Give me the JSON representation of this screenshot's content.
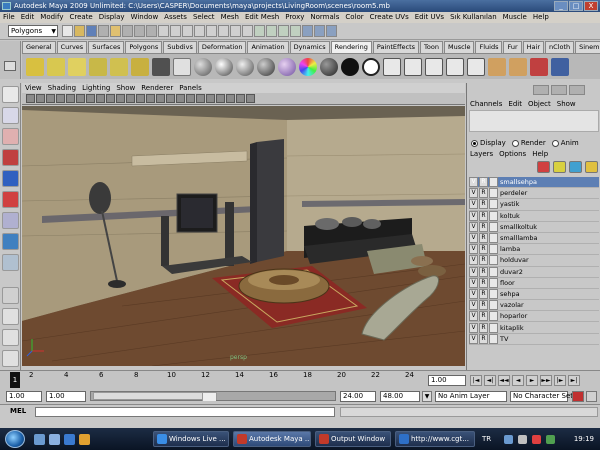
{
  "window": {
    "title": "Autodesk Maya 2009 Unlimited: C:\\Users\\CASPER\\Documents\\maya\\projects\\LivingRoom\\scenes\\room5.mb",
    "controls": [
      "_",
      "□",
      "X"
    ]
  },
  "menubar": [
    "File",
    "Edit",
    "Modify",
    "Create",
    "Display",
    "Window",
    "Assets",
    "Select",
    "Mesh",
    "Edit Mesh",
    "Proxy",
    "Normals",
    "Color",
    "Create UVs",
    "Edit UVs",
    "Sık Kullanılan",
    "Muscle",
    "Help"
  ],
  "mode_selector": {
    "value": "Polygons"
  },
  "shelf_tabs": [
    "General",
    "Curves",
    "Surfaces",
    "Polygons",
    "Subdivs",
    "Deformation",
    "Animation",
    "Dynamics",
    "Rendering",
    "PaintEffects",
    "Toon",
    "Muscle",
    "Fluids",
    "Fur",
    "Hair",
    "nCloth",
    "Sinem",
    "ersin"
  ],
  "active_shelf_tab": "Rendering",
  "panel_menu": [
    "View",
    "Shading",
    "Lighting",
    "Show",
    "Renderer",
    "Panels"
  ],
  "viewport": {
    "camera_label": "persp"
  },
  "channel_box": {
    "menu": [
      "Channels",
      "Edit",
      "Object",
      "Show"
    ]
  },
  "layer_editor": {
    "modes": [
      {
        "label": "Display",
        "selected": true
      },
      {
        "label": "Render",
        "selected": false
      },
      {
        "label": "Anim",
        "selected": false
      }
    ],
    "menu": [
      "Layers",
      "Options",
      "Help"
    ],
    "layers": [
      {
        "name": "smallsehpa",
        "v": "V",
        "r": "R",
        "selected": true
      },
      {
        "name": "perdeler",
        "v": "V",
        "r": "R",
        "selected": false
      },
      {
        "name": "yastik",
        "v": "V",
        "r": "R",
        "selected": false
      },
      {
        "name": "koltuk",
        "v": "V",
        "r": "R",
        "selected": false
      },
      {
        "name": "smallkoltuk",
        "v": "V",
        "r": "R",
        "selected": false
      },
      {
        "name": "smalllamba",
        "v": "V",
        "r": "R",
        "selected": false
      },
      {
        "name": "lamba",
        "v": "V",
        "r": "R",
        "selected": false
      },
      {
        "name": "holduvar",
        "v": "V",
        "r": "R",
        "selected": false
      },
      {
        "name": "duvar2",
        "v": "V",
        "r": "R",
        "selected": false
      },
      {
        "name": "floor",
        "v": "V",
        "r": "R",
        "selected": false
      },
      {
        "name": "sehpa",
        "v": "V",
        "r": "R",
        "selected": false
      },
      {
        "name": "vazolar",
        "v": "V",
        "r": "R",
        "selected": false
      },
      {
        "name": "hoparlor",
        "v": "V",
        "r": "R",
        "selected": false
      },
      {
        "name": "kitaplik",
        "v": "V",
        "r": "R",
        "selected": false
      },
      {
        "name": "TV",
        "v": "V",
        "r": "R",
        "selected": false
      }
    ]
  },
  "time_slider": {
    "ticks": [
      "2",
      "4",
      "6",
      "8",
      "10",
      "12",
      "14",
      "16",
      "18",
      "20",
      "22",
      "24"
    ],
    "current_frame": "1",
    "current_time_field": "1.00"
  },
  "playback_controls": [
    "|◄",
    "◄|",
    "◄◄",
    "◄",
    "►",
    "►►",
    "|►",
    "►|"
  ],
  "range_slider": {
    "start_time": "1.00",
    "playback_start": "1.00",
    "playback_end": "24.00",
    "end_time": "48.00",
    "anim_layer": "No Anim Layer",
    "character_set": "No Character Set"
  },
  "command_line": {
    "label": "MEL"
  },
  "taskbar": {
    "tasks": [
      {
        "label": "Windows Live ...",
        "active": false,
        "color": "#3a8ee6"
      },
      {
        "label": "Autodesk Maya ...",
        "active": true,
        "color": "#c23a2a"
      },
      {
        "label": "Output Window",
        "active": false,
        "color": "#c23a2a"
      },
      {
        "label": "http://www.cgt...",
        "active": false,
        "color": "#2e70c8"
      }
    ],
    "language": "TR",
    "clock": "19:19"
  }
}
